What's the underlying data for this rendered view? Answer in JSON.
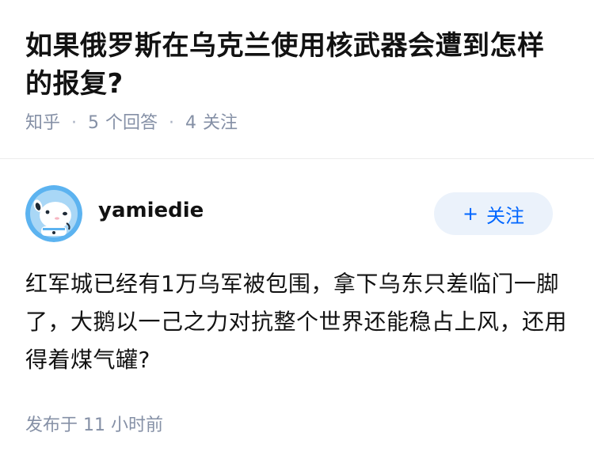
{
  "question": {
    "title": "如果俄罗斯在乌克兰使用核武器会遭到怎样的报复?",
    "source": "知乎",
    "answer_count": "5",
    "answer_label": "个回答",
    "follow_count": "4",
    "follow_label": "关注",
    "separator": "·"
  },
  "answer": {
    "author": "yamiedie",
    "avatar_icon": "white-dog-avatar",
    "follow_plus": "+",
    "follow_label": "关注",
    "content": "红军城已经有1万乌军被包围，拿下乌东只差临门一脚了，大鹅以一己之力对抗整个世界还能稳占上风，还用得着煤气罐?",
    "published": "发布于 11 小时前"
  },
  "colors": {
    "title": "#121212",
    "meta": "#8590a6",
    "accent": "#0066ff",
    "follow_bg": "#ebf2fb",
    "avatar_bg": "#5cb3f0"
  }
}
